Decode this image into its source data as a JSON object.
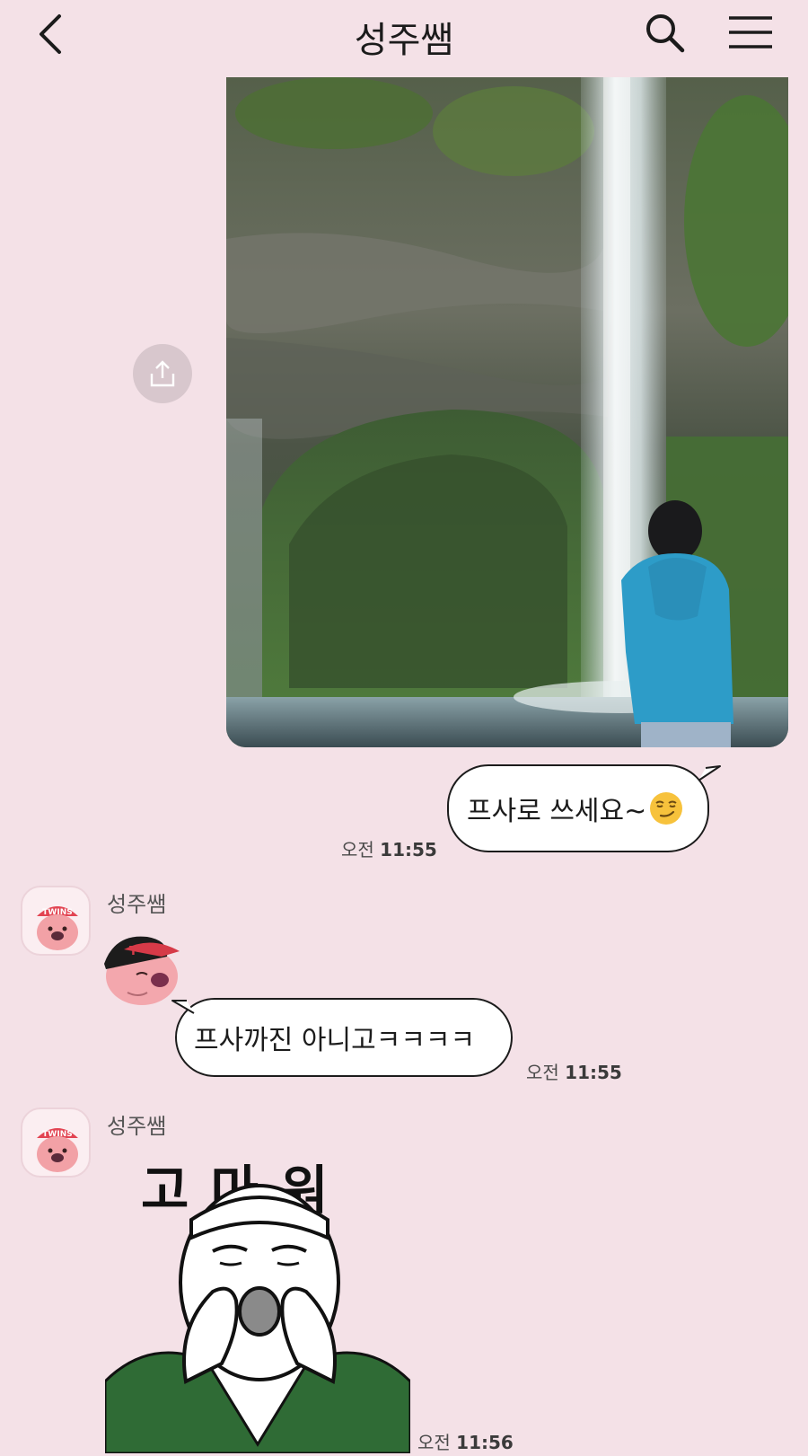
{
  "header": {
    "title": "성주쌤",
    "icons": {
      "back": "chevron-left-icon",
      "search": "search-icon",
      "menu": "hamburger-menu-icon"
    }
  },
  "colors": {
    "background": "#f4e1e7",
    "bubble": "#ffffff",
    "bubble_border": "#1c1c1c"
  },
  "messages": [
    {
      "type": "photo",
      "direction": "outgoing",
      "share_icon": "share-upload-icon",
      "image": "waterfall-photo"
    },
    {
      "type": "text",
      "direction": "outgoing",
      "text": "프사로 쓰세요~",
      "emoji": "smirk-emoji",
      "time_prefix": "오전",
      "time": "11:55"
    },
    {
      "type": "sticker",
      "direction": "incoming",
      "sender": "성주쌤",
      "sticker": "beaver-cap-sticker"
    },
    {
      "type": "text",
      "direction": "incoming",
      "text": "프사까진 아니고ㅋㅋㅋㅋ",
      "time_prefix": "오전",
      "time": "11:55"
    },
    {
      "type": "sticker",
      "direction": "incoming",
      "sender": "성주쌤",
      "sticker": "thank-you-shouting-sticker",
      "sticker_text": "고 마 워",
      "time_prefix": "오전",
      "time": "11:56"
    }
  ]
}
